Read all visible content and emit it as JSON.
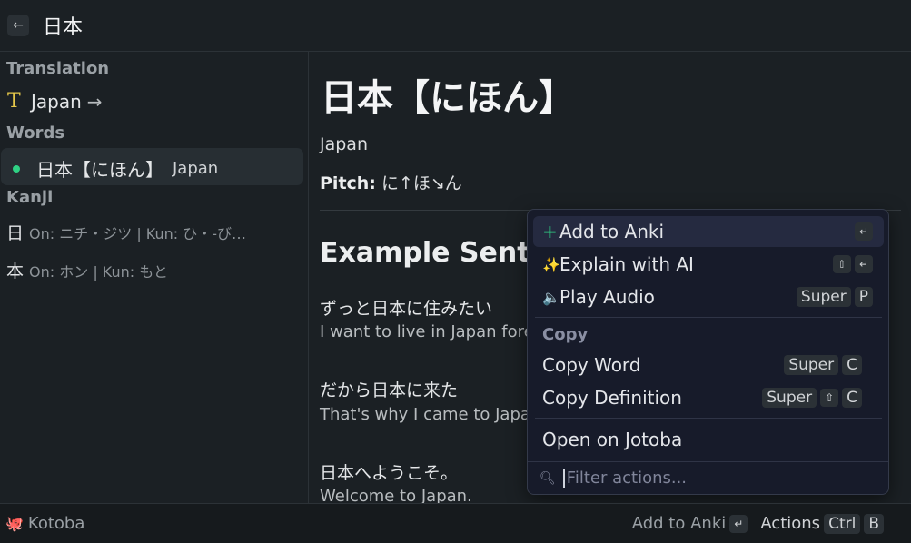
{
  "header": {
    "back_icon": "arrow-left-icon",
    "back_glyph": "←",
    "search_text": "日本"
  },
  "sidebar": {
    "translation_title": "Translation",
    "translation_item": {
      "icon": "text-t-icon",
      "icon_glyph": "T",
      "label": "Japan",
      "arrow": "→"
    },
    "words_title": "Words",
    "word_item": {
      "text": "日本【にほん】",
      "meaning": "Japan"
    },
    "kanji_title": "Kanji",
    "kanji_items": [
      {
        "char": "日",
        "desc": "On: ニチ・ジツ | Kun: ひ・-び…"
      },
      {
        "char": "本",
        "desc": "On: ホン | Kun: もと"
      }
    ]
  },
  "detail": {
    "title": "日本【にほん】",
    "meaning": "Japan",
    "pitch_label": "Pitch:",
    "pitch_value": " に↑ほ↘ん",
    "examples_heading": "Example Sentences",
    "examples": [
      {
        "jp": "ずっと日本に住みたい",
        "en": "I want to live in Japan forever"
      },
      {
        "jp": "だから日本に来た",
        "en": "That's why I came to Japan"
      },
      {
        "jp": "日本へようこそ。",
        "en": "Welcome to Japan."
      }
    ]
  },
  "menu": {
    "items": [
      {
        "label": "Add to Anki",
        "icon": "plus-icon",
        "glyph": "+",
        "keys": [
          "↵"
        ]
      },
      {
        "label": "Explain with AI",
        "icon": "magic-wand-icon",
        "glyph": "✨",
        "keys": [
          "⇧",
          "↵"
        ]
      },
      {
        "label": "Play Audio",
        "icon": "speaker-icon",
        "glyph": "🔈",
        "keys": [
          "Super",
          "P"
        ]
      }
    ],
    "copy_section": "Copy",
    "copy_items": [
      {
        "label": "Copy Word",
        "keys": [
          "Super",
          "C"
        ]
      },
      {
        "label": "Copy Definition",
        "keys": [
          "Super",
          "⇧",
          "C"
        ]
      }
    ],
    "open_item": {
      "label": "Open on Jotoba"
    },
    "filter_placeholder": "Filter actions..."
  },
  "footer": {
    "app_name": "Kotoba",
    "app_icon": "octopus-icon",
    "primary_action": "Add to Anki",
    "primary_key": "↵",
    "actions_label": "Actions",
    "actions_keys": [
      "Ctrl",
      "B"
    ]
  },
  "colors": {
    "background": "#1b2024",
    "accent_green": "#2fd184",
    "accent_yellow": "#e6c84a",
    "menu_bg": "#171b2a"
  }
}
